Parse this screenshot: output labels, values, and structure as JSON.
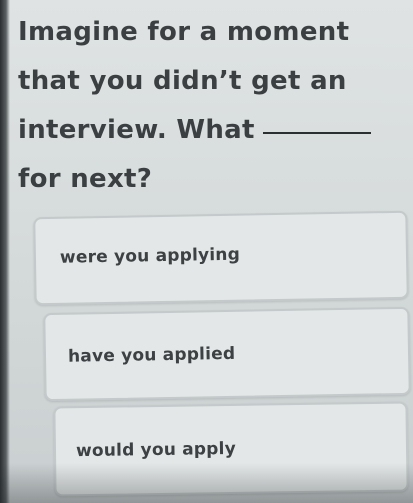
{
  "question": {
    "line1": "Imagine for a moment",
    "line2": "that you didn’t get an",
    "line3": "interview. What",
    "line4": "for next?"
  },
  "options": [
    {
      "label": "were you applying"
    },
    {
      "label": "have you applied"
    },
    {
      "label": "would you apply"
    }
  ]
}
